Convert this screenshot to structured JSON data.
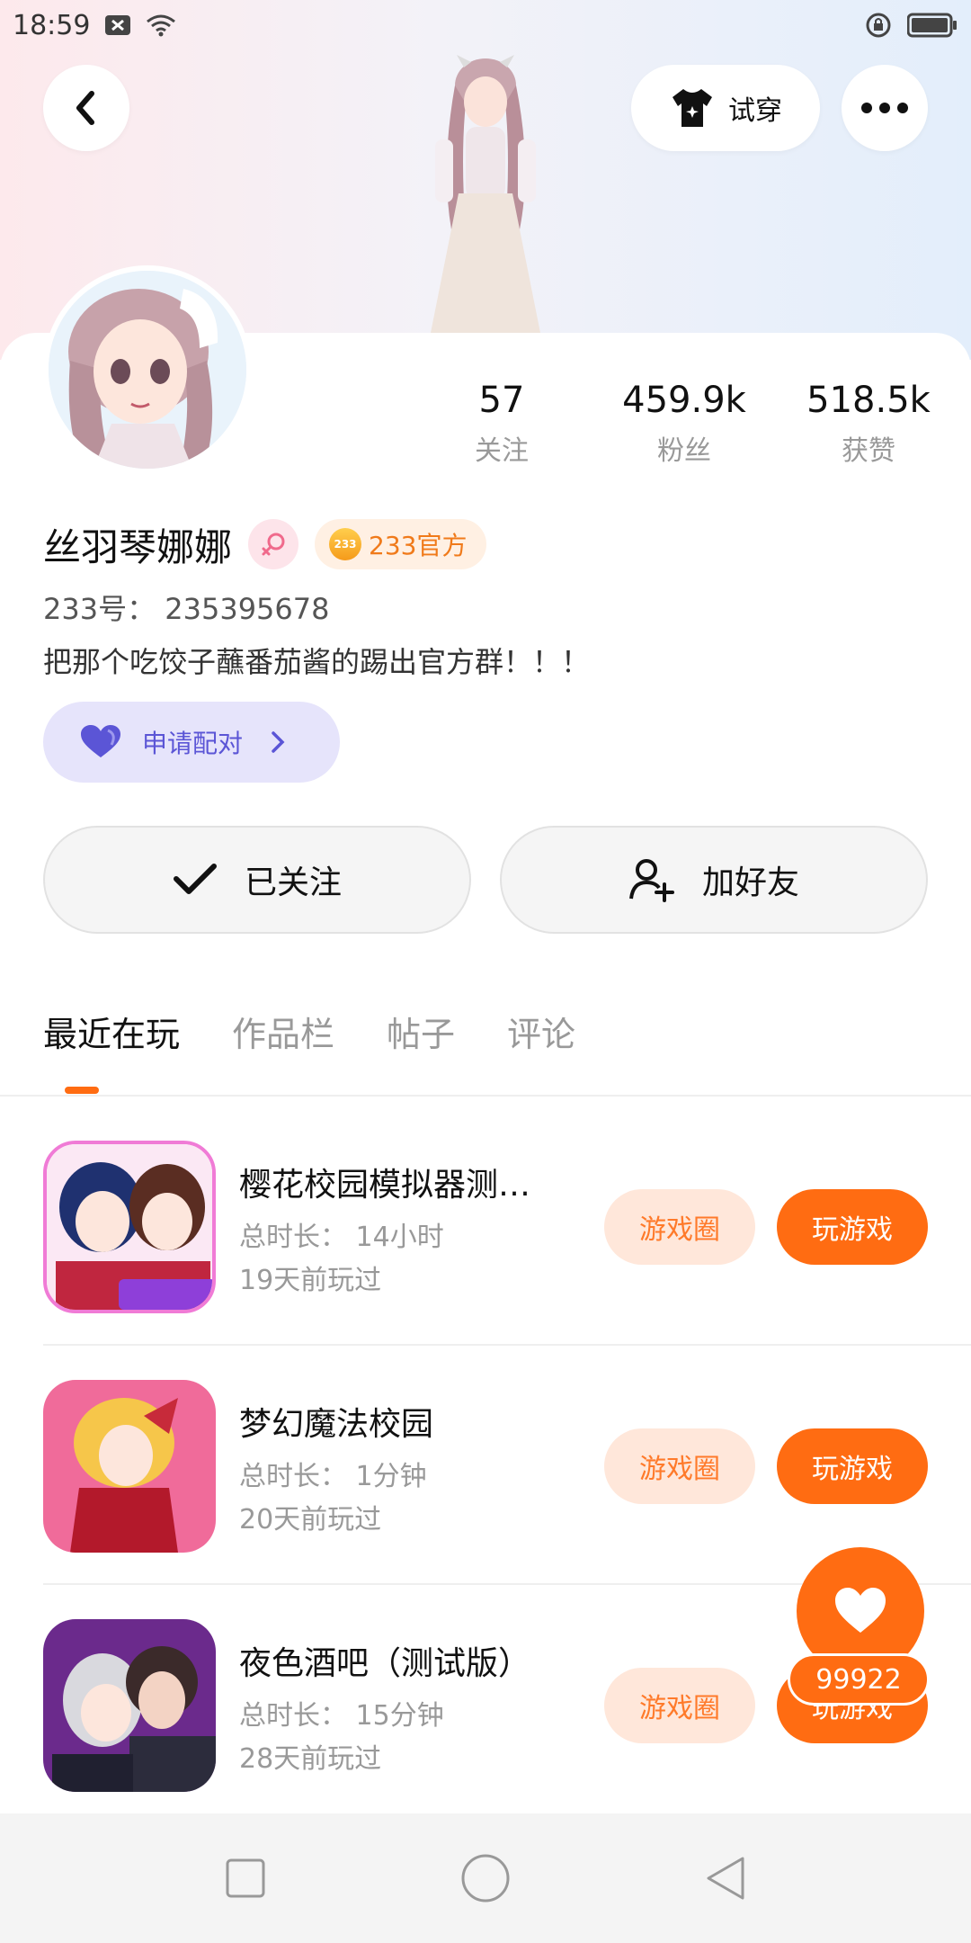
{
  "status_bar": {
    "time": "18:59"
  },
  "header": {
    "tryon_label": "试穿"
  },
  "profile": {
    "username": "丝羽琴娜娜",
    "official_badge": "233官方",
    "official_coin_text": "233",
    "user_id": "233号： 235395678",
    "bio": "把那个吃饺子蘸番茄酱的踢出官方群！！！",
    "pair_label": "申请配对"
  },
  "stats": [
    {
      "value": "57",
      "label": "关注"
    },
    {
      "value": "459.9k",
      "label": "粉丝"
    },
    {
      "value": "518.5k",
      "label": "获赞"
    }
  ],
  "actions": {
    "followed_label": "已关注",
    "add_friend_label": "加好友"
  },
  "tabs": [
    "最近在玩",
    "作品栏",
    "帖子",
    "评论"
  ],
  "active_tab": "最近在玩",
  "games": [
    {
      "title": "樱花校园模拟器测…",
      "duration": "总时长： 14小时",
      "last_played": "19天前玩过",
      "circle_label": "游戏圈",
      "play_label": "玩游戏"
    },
    {
      "title": "梦幻魔法校园",
      "duration": "总时长： 1分钟",
      "last_played": "20天前玩过",
      "circle_label": "游戏圈",
      "play_label": "玩游戏"
    },
    {
      "title": "夜色酒吧（测试版）",
      "duration": "总时长： 15分钟",
      "last_played": "28天前玩过",
      "circle_label": "游戏圈",
      "play_label": "玩游戏"
    }
  ],
  "like_count": "99922",
  "colors": {
    "accent": "#ff6c12",
    "accent_light": "#ffe7da",
    "pair_bg": "#e6e4fb",
    "pair_text": "#5b55d6"
  },
  "icons": [
    "back-icon",
    "tshirt-icon",
    "more-icon",
    "gender-female-icon",
    "heart-icon",
    "chevron-right-icon",
    "check-icon",
    "add-user-icon",
    "heart-fab-icon",
    "nav-square-icon",
    "nav-circle-icon",
    "nav-back-triangle-icon"
  ]
}
